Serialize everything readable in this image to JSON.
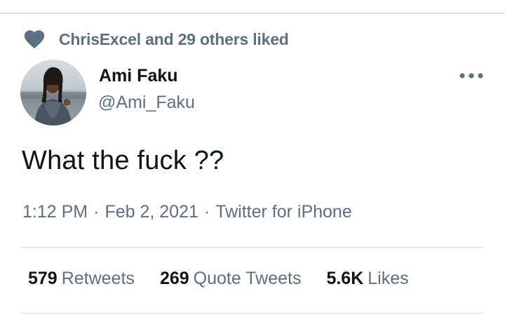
{
  "social_context": {
    "icon": "heart-icon",
    "text": "ChrisExcel and 29 others liked"
  },
  "tweet": {
    "author": {
      "name": "Ami Faku",
      "handle": "@Ami_Faku"
    },
    "text": "What the fuck ??",
    "time": "1:12 PM",
    "date": "Feb 2, 2021",
    "separator": "·",
    "source": "Twitter for iPhone"
  },
  "stats": {
    "retweets": {
      "count": "579",
      "label": "Retweets"
    },
    "quote_tweets": {
      "count": "269",
      "label": "Quote Tweets"
    },
    "likes": {
      "count": "5.6K",
      "label": "Likes"
    }
  },
  "colors": {
    "secondary_text": "#5b7083",
    "primary_text": "#0f1419",
    "divider": "#e6e8ea"
  }
}
